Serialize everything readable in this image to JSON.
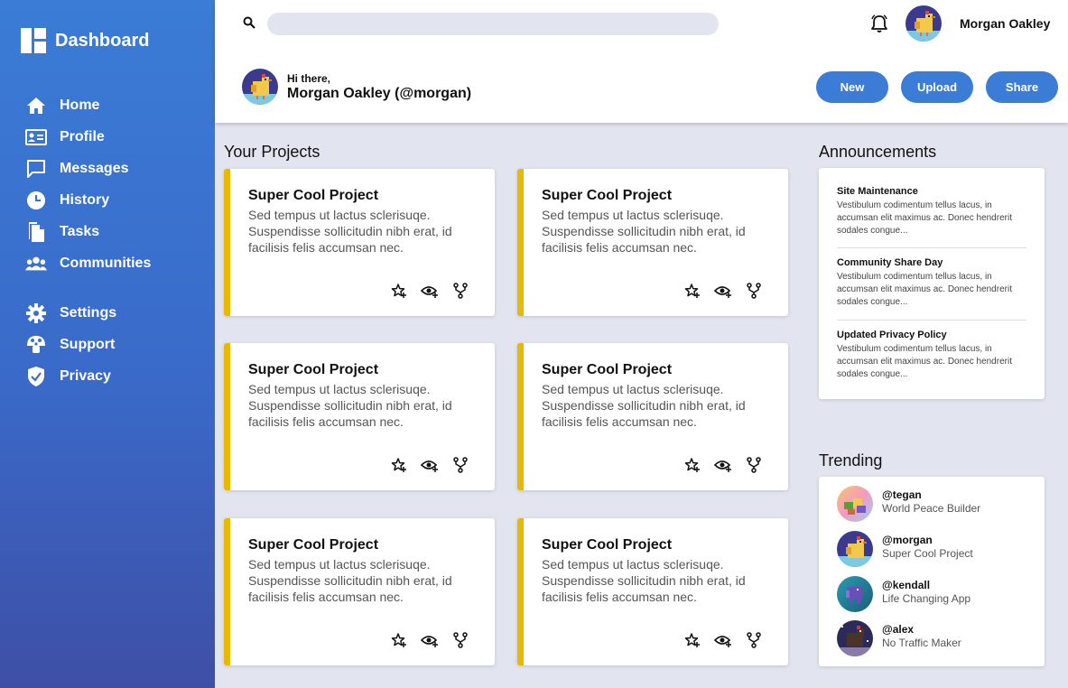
{
  "sidebar": {
    "title": "Dashboard",
    "nav": [
      {
        "label": "Home",
        "icon": "home-icon"
      },
      {
        "label": "Profile",
        "icon": "profile-card-icon"
      },
      {
        "label": "Messages",
        "icon": "message-icon"
      },
      {
        "label": "History",
        "icon": "clock-icon"
      },
      {
        "label": "Tasks",
        "icon": "document-icon"
      },
      {
        "label": "Communities",
        "icon": "people-icon"
      }
    ],
    "nav2": [
      {
        "label": "Settings",
        "icon": "gear-icon"
      },
      {
        "label": "Support",
        "icon": "mushroom-icon"
      },
      {
        "label": "Privacy",
        "icon": "shield-icon"
      }
    ]
  },
  "topbar": {
    "search_placeholder": "",
    "username": "Morgan Oakley",
    "greeting": "Hi there,",
    "display_name": "Morgan Oakley (@morgan)",
    "buttons": {
      "new": "New",
      "upload": "Upload",
      "share": "Share"
    }
  },
  "projects": {
    "heading": "Your Projects",
    "items": [
      {
        "title": "Super Cool Project",
        "desc": "Sed tempus ut lactus sclerisuqe. Suspendisse sollicitudin nibh erat, id facilisis felis accumsan nec."
      },
      {
        "title": "Super Cool Project",
        "desc": "Sed tempus ut lactus sclerisuqe. Suspendisse sollicitudin nibh erat, id facilisis felis accumsan nec."
      },
      {
        "title": "Super Cool Project",
        "desc": "Sed tempus ut lactus sclerisuqe. Suspendisse sollicitudin nibh erat, id facilisis felis accumsan nec."
      },
      {
        "title": "Super Cool Project",
        "desc": "Sed tempus ut lactus sclerisuqe. Suspendisse sollicitudin nibh erat, id facilisis felis accumsan nec."
      },
      {
        "title": "Super Cool Project",
        "desc": "Sed tempus ut lactus sclerisuqe. Suspendisse sollicitudin nibh erat, id facilisis felis accumsan nec."
      },
      {
        "title": "Super Cool Project",
        "desc": "Sed tempus ut lactus sclerisuqe. Suspendisse sollicitudin nibh erat, id facilisis felis accumsan nec."
      }
    ]
  },
  "announcements": {
    "heading": "Announcements",
    "items": [
      {
        "title": "Site Maintenance",
        "desc": "Vestibulum codimentum tellus lacus, in accumsan elit maximus ac. Donec hendrerit sodales congue..."
      },
      {
        "title": "Community Share Day",
        "desc": "Vestibulum codimentum tellus lacus, in accumsan elit maximus ac. Donec hendrerit sodales congue..."
      },
      {
        "title": "Updated Privacy Policy",
        "desc": "Vestibulum codimentum tellus lacus, in accumsan elit maximus ac. Donec hendrerit sodales congue..."
      }
    ]
  },
  "trending": {
    "heading": "Trending",
    "items": [
      {
        "handle": "@tegan",
        "project": "World Peace Builder"
      },
      {
        "handle": "@morgan",
        "project": "Super Cool Project"
      },
      {
        "handle": "@kendall",
        "project": "Life Changing App"
      },
      {
        "handle": "@alex",
        "project": "No Traffic Maker"
      }
    ]
  },
  "colors": {
    "accent": "#3a7cd6",
    "card_border": "#e8b900",
    "background": "#e2e5ef"
  }
}
